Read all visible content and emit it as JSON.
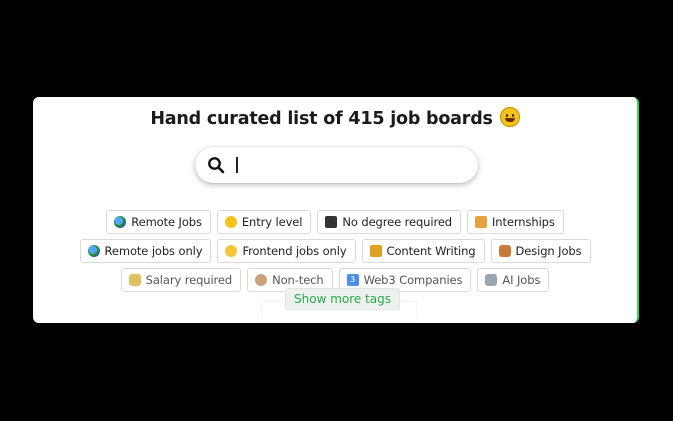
{
  "header": {
    "title": "Hand curated list of 415 job boards",
    "title_emoji": "grinning-face"
  },
  "search": {
    "value": "",
    "placeholder": ""
  },
  "tags": {
    "row1": [
      {
        "label": "Remote Jobs",
        "icon": "globe-icon"
      },
      {
        "label": "Entry level",
        "icon": "baby-icon"
      },
      {
        "label": "No degree required",
        "icon": "graduation-cap-icon"
      },
      {
        "label": "Internships",
        "icon": "book-icon"
      }
    ],
    "row2": [
      {
        "label": "Remote jobs only",
        "icon": "globe-icon"
      },
      {
        "label": "Frontend jobs only",
        "icon": "lightbulb-icon"
      },
      {
        "label": "Content Writing",
        "icon": "writing-hand-icon"
      },
      {
        "label": "Design Jobs",
        "icon": "artist-icon"
      }
    ],
    "row3": [
      {
        "label": "Salary required",
        "icon": "money-bag-icon"
      },
      {
        "label": "Non-tech",
        "icon": "monkey-icon"
      },
      {
        "label": "Web3 Companies",
        "icon": "web3-icon"
      },
      {
        "label": "AI Jobs",
        "icon": "robot-icon"
      }
    ]
  },
  "show_more": {
    "label": "Show more tags"
  },
  "colors": {
    "accent_green": "#2aa84a",
    "card_border_green": "#39d353",
    "background": "#000000"
  }
}
